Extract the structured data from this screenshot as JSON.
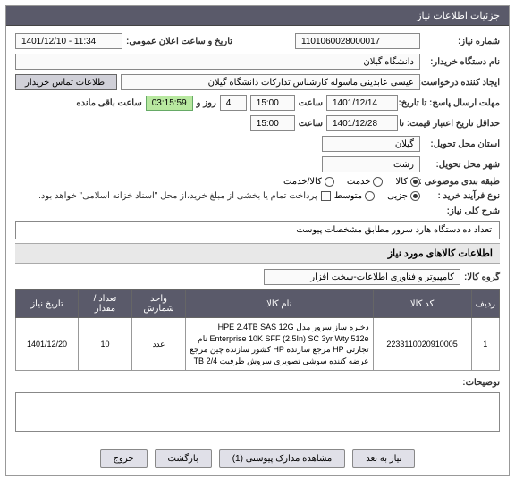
{
  "header": "جزئیات اطلاعات نیاز",
  "form": {
    "need_no_label": "شماره نیاز:",
    "need_no": "1101060028000017",
    "pub_date_label": "تاریخ و ساعت اعلان عمومی:",
    "pub_date": "1401/12/10 - 11:34",
    "buyer_label": "نام دستگاه خریدار:",
    "buyer": "دانشگاه گیلان",
    "requester_label": "ایجاد کننده درخواست:",
    "requester": "عیسی عابدینی ماسوله کارشناس تدارکات دانشگاه گیلان",
    "contact_btn": "اطلاعات تماس خریدار",
    "deadline_label": "مهلت ارسال پاسخ: تا تاریخ:",
    "deadline_date": "1401/12/14",
    "at_label": "ساعت",
    "deadline_time": "15:00",
    "days_remain": "4",
    "and_label": "روز و",
    "timer": "03:15:59",
    "remain_label": "ساعت باقی مانده",
    "quote_label": "حداقل تاریخ اعتبار قیمت: تا تاریخ:",
    "quote_date": "1401/12/28",
    "quote_time": "15:00",
    "province_label": "استان محل تحویل:",
    "province": "گیلان",
    "city_label": "شهر محل تحویل:",
    "city": "رشت",
    "class_label": "طبقه بندی موضوعی :",
    "class_kala": "کالا",
    "class_khedmat": "خدمت",
    "class_both": "کالا/خدمت",
    "process_label": "نوع فرآیند خرید :",
    "process_detailed": "جزیی",
    "process_medium": "متوسط",
    "payment_label": "پرداخت تمام یا بخشی از مبلغ خرید،از محل \"اسناد خزانه اسلامی\" خواهد بود.",
    "desc_title": "شرح کلی نیاز:",
    "desc": "تعداد ده دستگاه هارد سرور مطابق مشخصات پیوست",
    "goods_section": "اطلاعات کالاهای مورد نیاز",
    "group_label": "گروه کالا:",
    "group": "کامپیوتر و فناوری اطلاعات-سخت افزار",
    "explain_label": "توضیحات:"
  },
  "table": {
    "th_row": "ردیف",
    "th_code": "کد کالا",
    "th_name": "نام کالا",
    "th_unit": "واحد شمارش",
    "th_qty": "تعداد / مقدار",
    "th_date": "تاریخ نیاز",
    "rows": [
      {
        "idx": "1",
        "code": "2233110020910005",
        "name": "ذخیره ساز سرور مدل HPE 2.4TB SAS 12G Enterprise 10K SFF (2.5In) SC 3yr Wty 512e نام تجارتی HP مرجع سازنده HP کشور سازنده چین مرجع عرضه کننده سوشی تصویری سروش ظرفیت TB 2/4",
        "unit": "عدد",
        "qty": "10",
        "date": "1401/12/20"
      }
    ]
  },
  "footer": {
    "back": "نیاز به بعد",
    "attach": "مشاهده مدارک پیوستی (1)",
    "return": "بازگشت",
    "exit": "خروج"
  }
}
